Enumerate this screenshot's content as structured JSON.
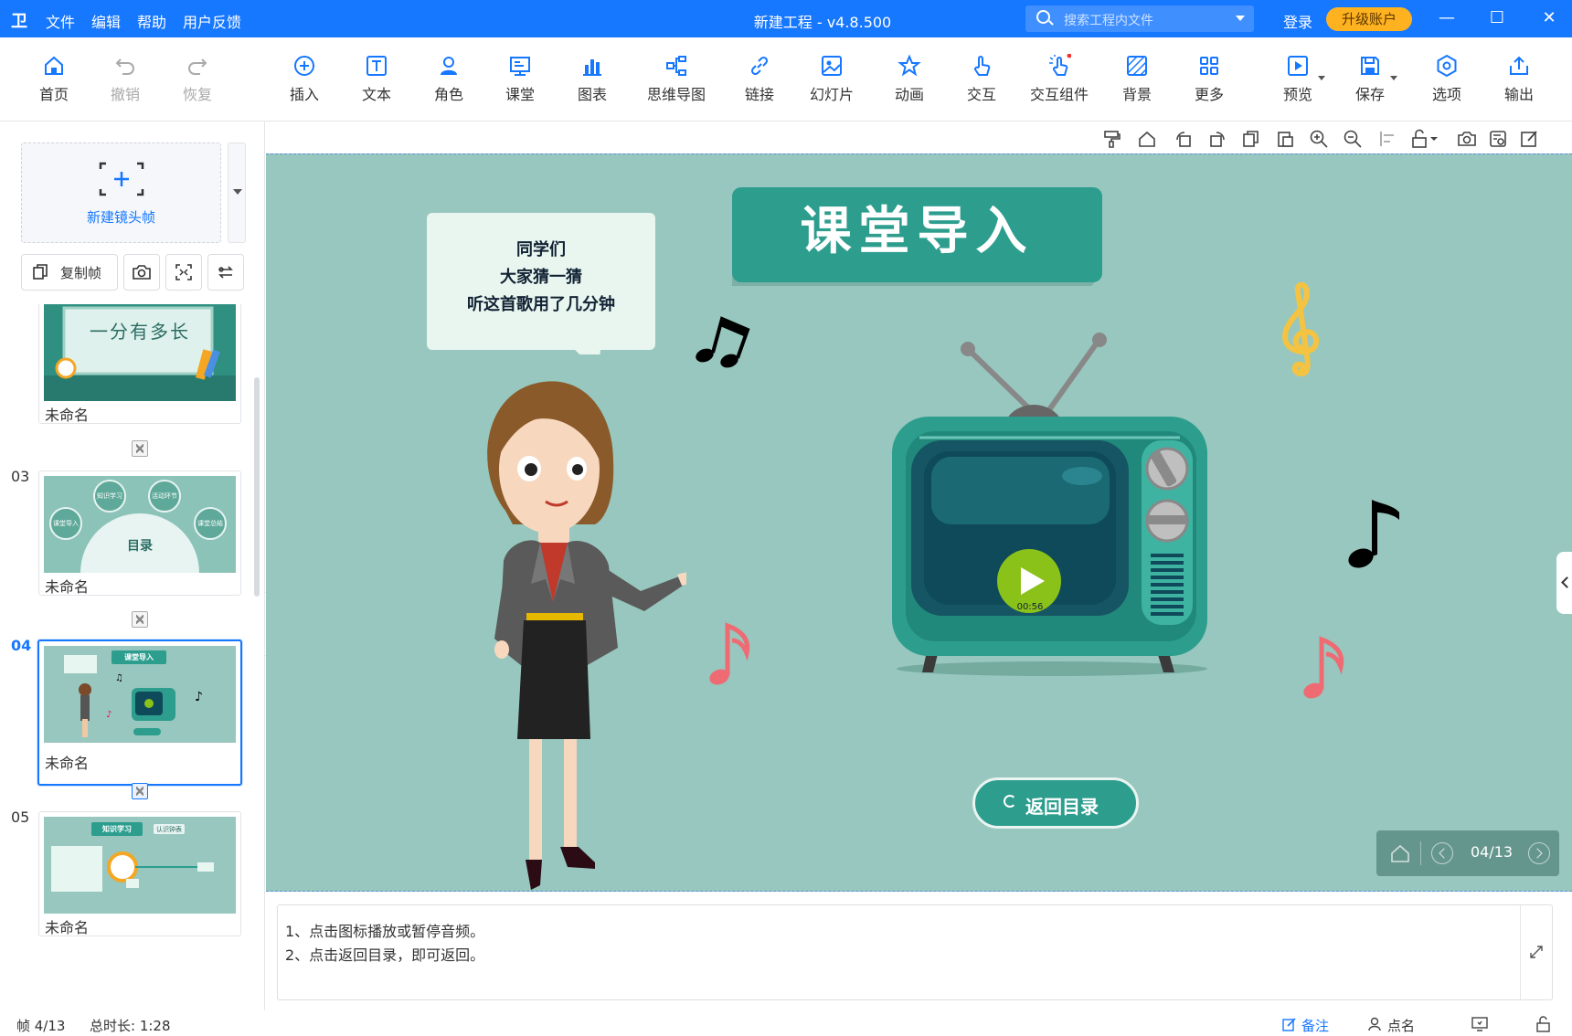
{
  "titlebar": {
    "logo": "卫",
    "menu": [
      "文件",
      "编辑",
      "帮助",
      "用户反馈"
    ],
    "title": "新建工程 - v4.8.500",
    "search_placeholder": "搜索工程内文件",
    "login": "登录",
    "upgrade": "升级账户",
    "window_controls": [
      "—",
      "☐",
      "✕"
    ]
  },
  "toolbar": {
    "items": [
      {
        "label": "首页",
        "icon": "home-icon"
      },
      {
        "label": "撤销",
        "icon": "undo-icon"
      },
      {
        "label": "恢复",
        "icon": "redo-icon"
      },
      {
        "label": "插入",
        "icon": "plus-circle-icon"
      },
      {
        "label": "文本",
        "icon": "text-icon"
      },
      {
        "label": "角色",
        "icon": "character-icon"
      },
      {
        "label": "课堂",
        "icon": "classroom-icon"
      },
      {
        "label": "图表",
        "icon": "chart-icon"
      },
      {
        "label": "思维导图",
        "icon": "mindmap-icon"
      },
      {
        "label": "链接",
        "icon": "link-icon"
      },
      {
        "label": "幻灯片",
        "icon": "slideshow-icon"
      },
      {
        "label": "动画",
        "icon": "animation-star-icon"
      },
      {
        "label": "交互",
        "icon": "touch-icon"
      },
      {
        "label": "交互组件",
        "icon": "interactive-component-icon"
      },
      {
        "label": "背景",
        "icon": "background-icon"
      },
      {
        "label": "更多",
        "icon": "more-grid-icon"
      },
      {
        "label": "预览",
        "icon": "preview-play-icon"
      },
      {
        "label": "保存",
        "icon": "save-icon"
      },
      {
        "label": "选项",
        "icon": "options-hex-icon"
      },
      {
        "label": "输出",
        "icon": "export-icon"
      }
    ]
  },
  "leftpanel": {
    "new_frame": "新建镜头帧",
    "copy_frame": "复制帧",
    "slides": [
      {
        "num": "",
        "name": "未命名",
        "thumb_text": "一分有多长"
      },
      {
        "num": "03",
        "name": "未命名",
        "thumb_text": "目录",
        "thumb_tags": [
          "知识学习",
          "活动环节",
          "课堂导入",
          "课堂总结"
        ]
      },
      {
        "num": "04",
        "name": "未命名",
        "thumb_text": "课堂导入",
        "active": true
      },
      {
        "num": "05",
        "name": "未命名",
        "thumb_text": "知识学习",
        "thumb_tag": "认识钟表"
      }
    ]
  },
  "stage": {
    "title": "课堂导入",
    "bubble_lines": [
      "同学们",
      "大家猜一猜",
      "听这首歌用了几分钟"
    ],
    "play_time": "00:56",
    "back_button": "返回目录",
    "pager": "04/13",
    "colors": {
      "bg": "#97c7be",
      "teal": "#2d9d8e",
      "dark_teal": "#1b6a63",
      "play_green": "#8bc21a"
    }
  },
  "notes": {
    "lines": [
      "1、点击图标播放或暂停音频。",
      "2、点击返回目录，即可返回。"
    ]
  },
  "statusbar": {
    "frame": "帧 4/13",
    "duration": "总时长: 1:28",
    "notes": "备注",
    "rollcall": "点名"
  }
}
